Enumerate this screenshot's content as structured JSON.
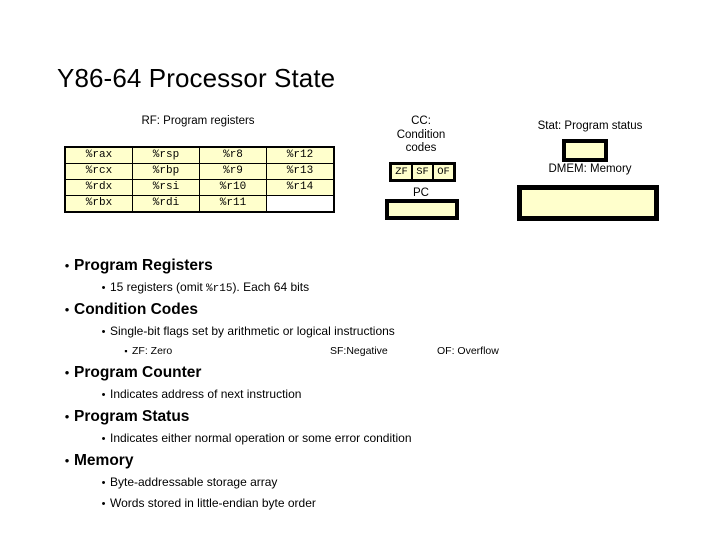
{
  "slide": {
    "title": "Y86-64 Processor State"
  },
  "diagram": {
    "register_file": {
      "label": "RF: Program registers",
      "rows": [
        [
          "%rax",
          "%rsp",
          "%r8",
          "%r12"
        ],
        [
          "%rcx",
          "%rbp",
          "%r9",
          "%r13"
        ],
        [
          "%rdx",
          "%rsi",
          "%r10",
          "%r14"
        ],
        [
          "%rbx",
          "%rdi",
          "%r11",
          ""
        ]
      ]
    },
    "condition_codes": {
      "label_line1": "CC:",
      "label_line2": "Condition",
      "label_line3": "codes",
      "flags": [
        "ZF",
        "SF",
        "OF"
      ]
    },
    "program_counter": {
      "label": "PC"
    },
    "program_status": {
      "label": "Stat: Program status"
    },
    "memory": {
      "label": "DMEM: Memory"
    },
    "colors": {
      "box_fill": "#ffffcc",
      "box_border": "#000000",
      "empty_cell_fill": "#ffffff"
    }
  },
  "bullets": {
    "program_registers": {
      "heading": "Program Registers",
      "detail_prefix": "15 registers (omit ",
      "detail_mono": "%r15",
      "detail_suffix": ").  Each 64 bits"
    },
    "condition_codes": {
      "heading": "Condition Codes",
      "detail": "Single-bit flags set by arithmetic or logical instructions",
      "flags": {
        "zf": "ZF: Zero",
        "sf": "SF:Negative",
        "of": "OF: Overflow"
      }
    },
    "program_counter": {
      "heading": "Program Counter",
      "detail": "Indicates address of next instruction"
    },
    "program_status": {
      "heading": "Program Status",
      "detail": "Indicates either normal operation or some error condition"
    },
    "memory": {
      "heading": "Memory",
      "detail1": "Byte-addressable storage array",
      "detail2": "Words stored in little-endian byte order"
    }
  },
  "markers": {
    "level1": "•",
    "level2": "•",
    "level3": "▪"
  }
}
